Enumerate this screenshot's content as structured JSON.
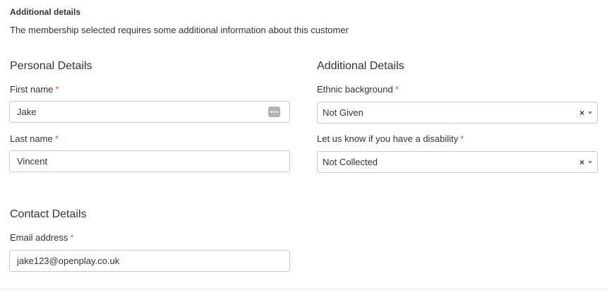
{
  "header": {
    "title": "Additional details",
    "description": "The membership selected requires some additional information about this customer"
  },
  "personal": {
    "section_title": "Personal Details",
    "first_name": {
      "label": "First name",
      "required": "*",
      "value": "Jake"
    },
    "last_name": {
      "label": "Last name",
      "required": "*",
      "value": "Vincent"
    }
  },
  "additional": {
    "section_title": "Additional Details",
    "ethnic": {
      "label": "Ethnic background",
      "required": "*",
      "value": "Not Given",
      "clear": "×"
    },
    "disability": {
      "label": "Let us know if you have a disability",
      "required": "*",
      "value": "Not Collected",
      "clear": "×"
    }
  },
  "contact": {
    "section_title": "Contact Details",
    "email": {
      "label": "Email address",
      "required": "*",
      "value": "jake123@openplay.co.uk"
    }
  },
  "colors": {
    "required_marker": "#d9534f",
    "input_border": "#c9c9c9",
    "text": "#333333"
  },
  "icons": {
    "autofill": "ellipsis-icon",
    "dropdown": "chevron-down-icon",
    "clear": "clear-icon"
  }
}
